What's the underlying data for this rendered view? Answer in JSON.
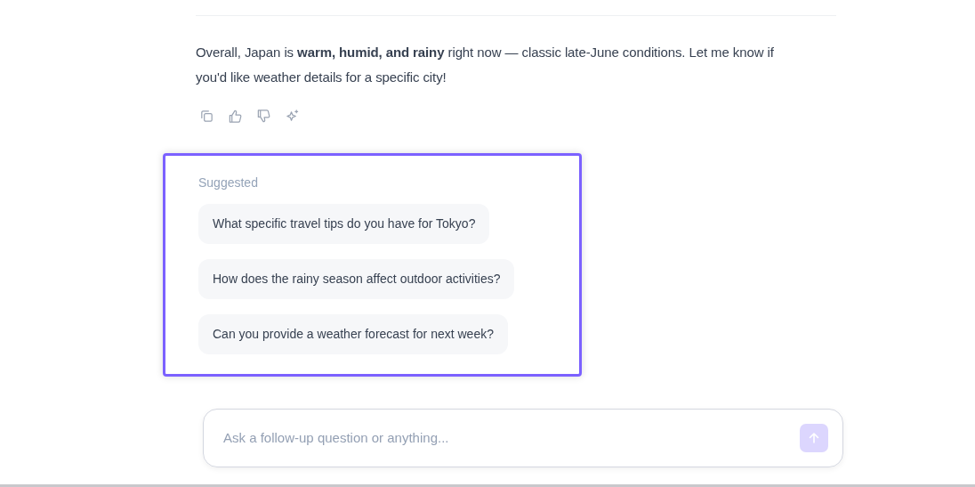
{
  "message": {
    "text": "Overall, Japan is **warm, humid, and rainy** right now — classic late-June conditions. Let me know if you'd like weather details for a specific city!"
  },
  "actions": [
    {
      "kind": "copy"
    },
    {
      "kind": "like"
    },
    {
      "kind": "dislike"
    },
    {
      "kind": "sparkle"
    }
  ],
  "suggested": {
    "title": "Suggested",
    "highlighted": true,
    "items": [
      {
        "text": "What specific travel tips do you have for Tokyo?"
      },
      {
        "text": "How does the rainy season affect outdoor activities?"
      },
      {
        "text": "Can you provide a weather forecast for next week?"
      }
    ]
  },
  "composer": {
    "placeholder": "Ask a follow-up question or anything...",
    "send_disabled": true
  }
}
